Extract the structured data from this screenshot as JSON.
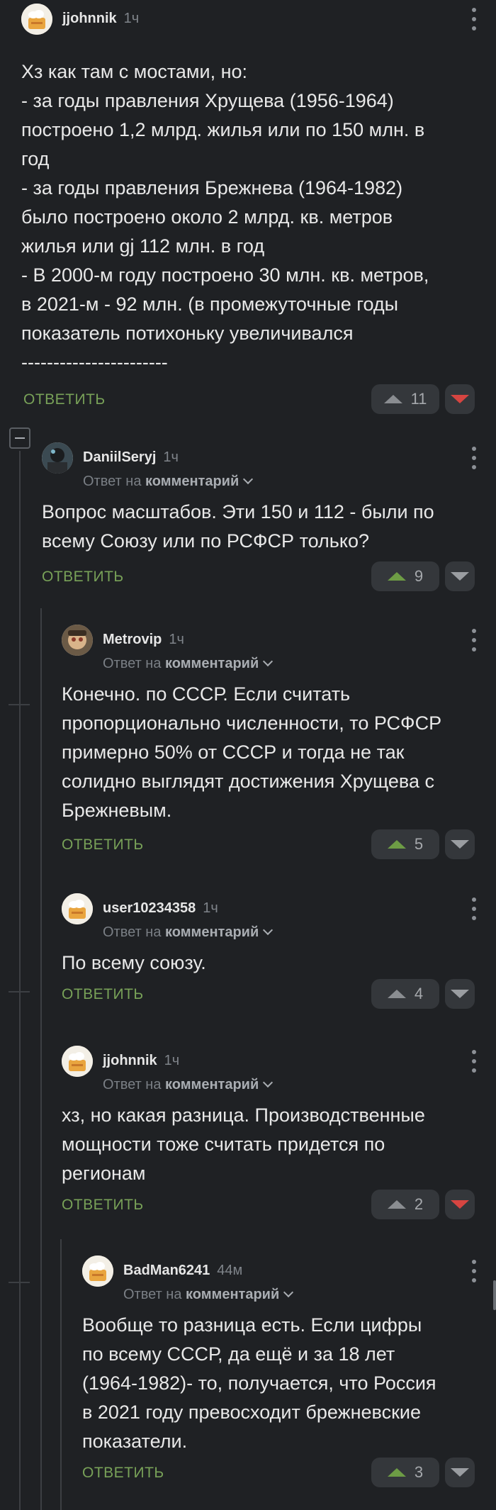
{
  "comments": [
    {
      "username": "jjohnnik",
      "time": "1ч",
      "reply_label": "",
      "reply_target": "",
      "body": "Хз как там с мостами, но:\n- за годы правления Хрущева (1956-1964)\nпостроено 1,2 млрд. жилья или по 150 млн. в\nгод\n- за годы правления Брежнева (1964-1982)\nбыло построено около 2 млрд. кв. метров\nжилья или gj 112 млн. в год\n- В 2000-м году построено 30 млн. кв. метров,\nв 2021-м - 92 млн. (в промежуточные годы\nпоказатель потихоньку увеличивался\n-----------------------",
      "reply_button": "ОТВЕТИТЬ",
      "score": "11",
      "vote_state": "down"
    },
    {
      "username": "DaniilSeryj",
      "time": "1ч",
      "reply_label": "Ответ на",
      "reply_target": "комментарий",
      "body": "Вопрос масштабов. Эти 150 и 112 - были по\nвсему Союзу или по РСФСР только?",
      "reply_button": "ОТВЕТИТЬ",
      "score": "9",
      "vote_state": "up"
    },
    {
      "username": "Metrovip",
      "time": "1ч",
      "reply_label": "Ответ на",
      "reply_target": "комментарий",
      "body": "Конечно. по СССР. Если считать\nпропорционально численности, то РСФСР\nпримерно 50% от СССР и тогда не так\nсолидно выглядят достижения Хрущева с\nБрежневым.",
      "reply_button": "ОТВЕТИТЬ",
      "score": "5",
      "vote_state": "up"
    },
    {
      "username": "user10234358",
      "time": "1ч",
      "reply_label": "Ответ на",
      "reply_target": "комментарий",
      "body": "По всему союзу.",
      "reply_button": "ОТВЕТИТЬ",
      "score": "4",
      "vote_state": "none"
    },
    {
      "username": "jjohnnik",
      "time": "1ч",
      "reply_label": "Ответ на",
      "reply_target": "комментарий",
      "body": "хз, но какая разница. Производственные\nмощности тоже считать придется по\nрегионам",
      "reply_button": "ОТВЕТИТЬ",
      "score": "2",
      "vote_state": "down"
    },
    {
      "username": "BadMan6241",
      "time": "44м",
      "reply_label": "Ответ на",
      "reply_target": "комментарий",
      "body": "Вообще то разница есть. Если цифры\nпо всему СССР, да ещё и за 18 лет\n(1964-1982)- то, получается, что Россия\nв 2021 году превосходит брежневские\nпоказатели.",
      "reply_button": "ОТВЕТИТЬ",
      "score": "3",
      "vote_state": "up"
    }
  ],
  "colors": {
    "background": "#1f2124",
    "reply": "#78a158",
    "upvoted": "#6d9c45",
    "downvoted": "#d64541"
  }
}
